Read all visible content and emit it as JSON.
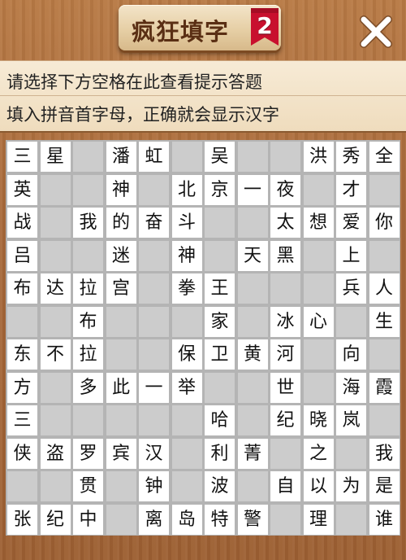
{
  "header": {
    "title": "疯狂填字",
    "badge": "2",
    "close_icon": "close-icon"
  },
  "hint": {
    "line1": "请选择下方空格在此查看提示答题",
    "line2": "填入拼音首字母，正确就会显示汉字"
  },
  "board": {
    "rows": 12,
    "cols": 12,
    "cells": [
      [
        "三",
        "星",
        null,
        "潘",
        "虹",
        null,
        "吴",
        null,
        null,
        "洪",
        "秀",
        "全"
      ],
      [
        "英",
        null,
        null,
        "神",
        null,
        "北",
        "京",
        "一",
        "夜",
        null,
        "才",
        null
      ],
      [
        "战",
        null,
        "我",
        "的",
        "奋",
        "斗",
        null,
        null,
        "太",
        "想",
        "爱",
        "你"
      ],
      [
        "吕",
        null,
        null,
        "迷",
        null,
        "神",
        null,
        "天",
        "黑",
        null,
        "上",
        null
      ],
      [
        "布",
        "达",
        "拉",
        "宫",
        null,
        "拳",
        "王",
        null,
        null,
        null,
        "兵",
        "人"
      ],
      [
        null,
        null,
        "布",
        null,
        null,
        null,
        "家",
        null,
        "冰",
        "心",
        null,
        "生"
      ],
      [
        "东",
        "不",
        "拉",
        null,
        null,
        "保",
        "卫",
        "黄",
        "河",
        null,
        "向",
        null
      ],
      [
        "方",
        null,
        "多",
        "此",
        "一",
        "举",
        null,
        null,
        "世",
        null,
        "海",
        "霞"
      ],
      [
        "三",
        null,
        null,
        null,
        null,
        null,
        "哈",
        null,
        "纪",
        "晓",
        "岚",
        null
      ],
      [
        "侠",
        "盗",
        "罗",
        "宾",
        "汉",
        null,
        "利",
        "菁",
        null,
        "之",
        null,
        "我"
      ],
      [
        null,
        null,
        "贯",
        null,
        "钟",
        null,
        "波",
        null,
        "自",
        "以",
        "为",
        "是"
      ],
      [
        "张",
        "纪",
        "中",
        null,
        "离",
        "岛",
        "特",
        "警",
        null,
        "理",
        null,
        "谁"
      ]
    ],
    "white": [
      [
        1,
        1,
        0,
        1,
        1,
        0,
        1,
        0,
        0,
        1,
        1,
        1
      ],
      [
        1,
        0,
        0,
        1,
        0,
        1,
        1,
        1,
        1,
        0,
        1,
        0
      ],
      [
        1,
        0,
        1,
        1,
        1,
        1,
        0,
        0,
        1,
        1,
        1,
        1
      ],
      [
        1,
        0,
        0,
        1,
        0,
        1,
        0,
        1,
        1,
        0,
        1,
        0
      ],
      [
        1,
        1,
        1,
        1,
        0,
        1,
        1,
        0,
        0,
        0,
        1,
        1
      ],
      [
        0,
        0,
        1,
        0,
        0,
        0,
        1,
        0,
        1,
        1,
        0,
        1
      ],
      [
        1,
        1,
        1,
        0,
        0,
        1,
        1,
        1,
        1,
        0,
        1,
        0
      ],
      [
        1,
        0,
        1,
        1,
        1,
        1,
        0,
        0,
        1,
        0,
        1,
        1
      ],
      [
        1,
        0,
        0,
        0,
        0,
        0,
        1,
        0,
        1,
        1,
        1,
        0
      ],
      [
        1,
        1,
        1,
        1,
        1,
        0,
        1,
        1,
        0,
        1,
        0,
        1
      ],
      [
        0,
        0,
        1,
        0,
        1,
        0,
        1,
        0,
        1,
        1,
        1,
        1
      ],
      [
        1,
        1,
        1,
        0,
        1,
        1,
        1,
        1,
        0,
        1,
        0,
        1
      ]
    ]
  }
}
